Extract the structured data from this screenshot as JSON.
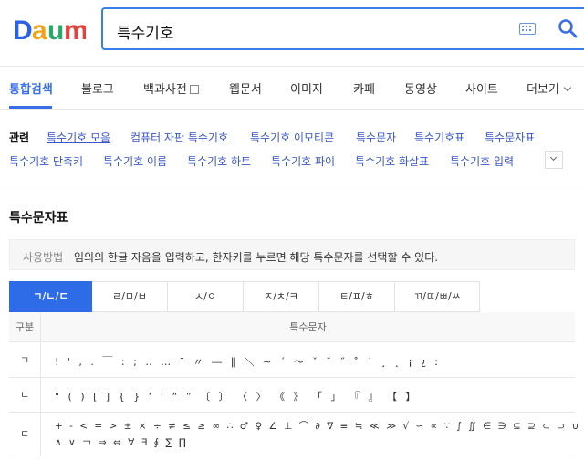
{
  "header": {
    "logo_text": "Daum",
    "search_value": "특수기호"
  },
  "tabs": [
    {
      "label": "통합검색",
      "active": true
    },
    {
      "label": "블로그"
    },
    {
      "label": "백과사전"
    },
    {
      "label": "웹문서"
    },
    {
      "label": "이미지"
    },
    {
      "label": "카페"
    },
    {
      "label": "동영상"
    },
    {
      "label": "사이트"
    },
    {
      "label": "더보기"
    }
  ],
  "related": {
    "label": "관련",
    "row1": [
      "특수기호 모음",
      "컴퓨터 자판 특수기호",
      "특수기호 이모티콘",
      "특수문자",
      "특수기호표",
      "특수문자표"
    ],
    "row2": [
      "특수기호 단축키",
      "특수기호 이름",
      "특수기호 하트",
      "특수기호 파이",
      "특수기호 화살표",
      "특수기호 입력"
    ]
  },
  "section": {
    "title": "특수문자표",
    "usage_label": "사용방법",
    "usage_text": "임의의 한글 자음을 입력하고, 한자키를 누르면 해당 특수문자를 선택할 수 있다."
  },
  "consonant_tabs": [
    "ㄱ/ㄴ/ㄷ",
    "ㄹ/ㅁ/ㅂ",
    "ㅅ/ㅇ",
    "ㅈ/ㅊ/ㅋ",
    "ㅌ/ㅍ/ㅎ",
    "ㄲ/ㄸ/ㅃ/ㅆ"
  ],
  "table": {
    "col1": "구분",
    "col2": "특수문자",
    "rows": [
      {
        "key": "ㄱ",
        "chars": "! ' , . ￣ : ; ‥ … ¨ 〃 ― ∥ ＼ ∼ ´ ～ ˇ ˘ ˝ ˚ ˙ ¸ ˛ ¡ ¿ ː"
      },
      {
        "key": "ㄴ",
        "chars": "\" ( ) [ ] { } ‘ ’ “ ” 〔 〕 〈 〉 《 》 「 」 『 』 【 】"
      },
      {
        "key": "ㄷ",
        "chars": "+ - < = > ± × ÷ ≠ ≤ ≥ ∞ ∴ ♂ ♀ ∠ ⊥ ⌒ ∂ ∇ ≡ ≒ ≪ ≫ √ ∽ ∝ ∵ ∫ ∬ ∈ ∋ ⊆ ⊇ ⊂ ⊃ ∪ ∩",
        "chars2": "∧ ∨ ￢ ⇒ ⇔ ∀ ∃ ∮ ∑ ∏"
      }
    ]
  }
}
